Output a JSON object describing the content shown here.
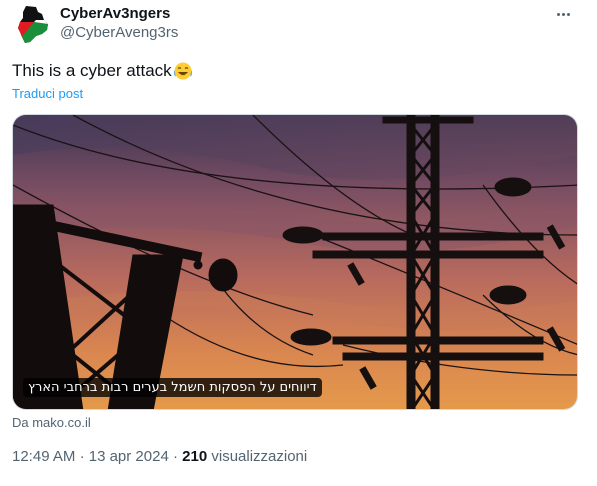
{
  "author": {
    "display_name": "CyberAv3ngers",
    "handle": "@CyberAveng3rs",
    "avatar_icon": "map-flag-avatar-icon"
  },
  "more_icon": "more-options-icon",
  "tweet": {
    "text": "This is a cyber attack",
    "emoji": "face-with-tears-of-joy",
    "translate_label": "Traduci post"
  },
  "media": {
    "caption": "דיווחים על הפסקות חשמל בערים רבות ברחבי הארץ",
    "source": "Da mako.co.il"
  },
  "meta": {
    "time": "12:49 AM",
    "separator1": "·",
    "date": "13 apr 2024",
    "separator2": "·",
    "views_count": "210",
    "views_label": "visualizzazioni"
  },
  "colors": {
    "link": "#1d9bf0",
    "secondary_text": "#536471",
    "primary_text": "#0f1419"
  }
}
